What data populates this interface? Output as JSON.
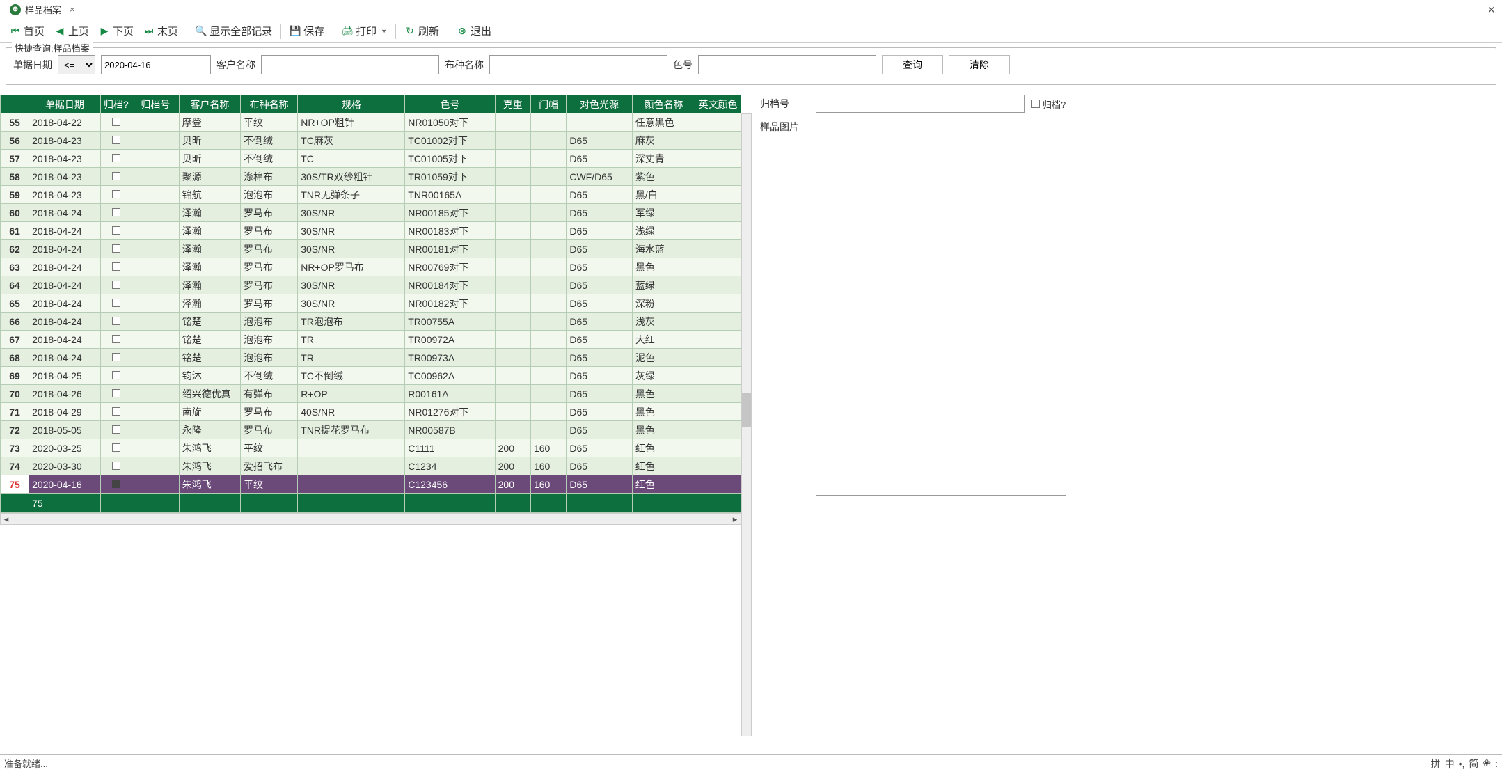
{
  "tab": {
    "title": "样品档案",
    "close": "×"
  },
  "window_close": "×",
  "toolbar": {
    "first": "首页",
    "prev": "上页",
    "next": "下页",
    "last": "末页",
    "showall": "显示全部记录",
    "save": "保存",
    "print": "打印",
    "refresh": "刷新",
    "exit": "退出"
  },
  "query": {
    "legend": "快捷查询:样品档案",
    "date_label": "单据日期",
    "op": "<=",
    "date": "2020-04-16",
    "cust_label": "客户名称",
    "cust": "",
    "fabric_label": "布种名称",
    "fabric": "",
    "color_label": "色号",
    "color": "",
    "search": "查询",
    "clear": "清除"
  },
  "columns": [
    "单据日期",
    "归档?",
    "归档号",
    "客户名称",
    "布种名称",
    "规格",
    "色号",
    "克重",
    "门幅",
    "对色光源",
    "颜色名称",
    "英文颜色"
  ],
  "rows": [
    {
      "n": "55",
      "date": "2018-04-22",
      "arch": false,
      "archno": "",
      "cust": "摩登",
      "fabric": "平纹",
      "spec": "NR+OP粗针",
      "colorno": "NR01050对下",
      "weight": "",
      "width": "",
      "light": "",
      "colorname": "任意黑色",
      "eng": ""
    },
    {
      "n": "56",
      "date": "2018-04-23",
      "arch": false,
      "archno": "",
      "cust": "贝昕",
      "fabric": "不倒绒",
      "spec": "TC麻灰",
      "colorno": "TC01002对下",
      "weight": "",
      "width": "",
      "light": "D65",
      "colorname": "麻灰",
      "eng": ""
    },
    {
      "n": "57",
      "date": "2018-04-23",
      "arch": false,
      "archno": "",
      "cust": "贝昕",
      "fabric": "不倒绒",
      "spec": "TC",
      "colorno": "TC01005对下",
      "weight": "",
      "width": "",
      "light": "D65",
      "colorname": "深丈青",
      "eng": ""
    },
    {
      "n": "58",
      "date": "2018-04-23",
      "arch": false,
      "archno": "",
      "cust": "聚源",
      "fabric": "涤棉布",
      "spec": "30S/TR双纱粗针",
      "colorno": "TR01059对下",
      "weight": "",
      "width": "",
      "light": "CWF/D65",
      "colorname": "紫色",
      "eng": ""
    },
    {
      "n": "59",
      "date": "2018-04-23",
      "arch": false,
      "archno": "",
      "cust": "锦航",
      "fabric": "泡泡布",
      "spec": "TNR无弹条子",
      "colorno": "TNR00165A",
      "weight": "",
      "width": "",
      "light": "D65",
      "colorname": "黑/白",
      "eng": ""
    },
    {
      "n": "60",
      "date": "2018-04-24",
      "arch": false,
      "archno": "",
      "cust": "泽瀚",
      "fabric": "罗马布",
      "spec": "30S/NR",
      "colorno": "NR00185对下",
      "weight": "",
      "width": "",
      "light": "D65",
      "colorname": "军绿",
      "eng": ""
    },
    {
      "n": "61",
      "date": "2018-04-24",
      "arch": false,
      "archno": "",
      "cust": "泽瀚",
      "fabric": "罗马布",
      "spec": "30S/NR",
      "colorno": "NR00183对下",
      "weight": "",
      "width": "",
      "light": "D65",
      "colorname": "浅绿",
      "eng": ""
    },
    {
      "n": "62",
      "date": "2018-04-24",
      "arch": false,
      "archno": "",
      "cust": "泽瀚",
      "fabric": "罗马布",
      "spec": "30S/NR",
      "colorno": "NR00181对下",
      "weight": "",
      "width": "",
      "light": "D65",
      "colorname": "海水蓝",
      "eng": ""
    },
    {
      "n": "63",
      "date": "2018-04-24",
      "arch": false,
      "archno": "",
      "cust": "泽瀚",
      "fabric": "罗马布",
      "spec": "NR+OP罗马布",
      "colorno": "NR00769对下",
      "weight": "",
      "width": "",
      "light": "D65",
      "colorname": "黑色",
      "eng": ""
    },
    {
      "n": "64",
      "date": "2018-04-24",
      "arch": false,
      "archno": "",
      "cust": "泽瀚",
      "fabric": "罗马布",
      "spec": "30S/NR",
      "colorno": "NR00184对下",
      "weight": "",
      "width": "",
      "light": "D65",
      "colorname": "蓝绿",
      "eng": ""
    },
    {
      "n": "65",
      "date": "2018-04-24",
      "arch": false,
      "archno": "",
      "cust": "泽瀚",
      "fabric": "罗马布",
      "spec": "30S/NR",
      "colorno": "NR00182对下",
      "weight": "",
      "width": "",
      "light": "D65",
      "colorname": "深粉",
      "eng": ""
    },
    {
      "n": "66",
      "date": "2018-04-24",
      "arch": false,
      "archno": "",
      "cust": "铭楚",
      "fabric": "泡泡布",
      "spec": "TR泡泡布",
      "colorno": "TR00755A",
      "weight": "",
      "width": "",
      "light": "D65",
      "colorname": "浅灰",
      "eng": ""
    },
    {
      "n": "67",
      "date": "2018-04-24",
      "arch": false,
      "archno": "",
      "cust": "铭楚",
      "fabric": "泡泡布",
      "spec": "TR",
      "colorno": "TR00972A",
      "weight": "",
      "width": "",
      "light": "D65",
      "colorname": "大红",
      "eng": ""
    },
    {
      "n": "68",
      "date": "2018-04-24",
      "arch": false,
      "archno": "",
      "cust": "铭楚",
      "fabric": "泡泡布",
      "spec": "TR",
      "colorno": "TR00973A",
      "weight": "",
      "width": "",
      "light": "D65",
      "colorname": "泥色",
      "eng": ""
    },
    {
      "n": "69",
      "date": "2018-04-25",
      "arch": false,
      "archno": "",
      "cust": "钧沐",
      "fabric": "不倒绒",
      "spec": "TC不倒绒",
      "colorno": "TC00962A",
      "weight": "",
      "width": "",
      "light": "D65",
      "colorname": "灰绿",
      "eng": ""
    },
    {
      "n": "70",
      "date": "2018-04-26",
      "arch": false,
      "archno": "",
      "cust": "绍兴德优真",
      "fabric": "有弹布",
      "spec": "R+OP",
      "colorno": "R00161A",
      "weight": "",
      "width": "",
      "light": "D65",
      "colorname": "黑色",
      "eng": ""
    },
    {
      "n": "71",
      "date": "2018-04-29",
      "arch": false,
      "archno": "",
      "cust": "南旋",
      "fabric": "罗马布",
      "spec": "40S/NR",
      "colorno": "NR01276对下",
      "weight": "",
      "width": "",
      "light": "D65",
      "colorname": "黑色",
      "eng": ""
    },
    {
      "n": "72",
      "date": "2018-05-05",
      "arch": false,
      "archno": "",
      "cust": "永隆",
      "fabric": "罗马布",
      "spec": "TNR提花罗马布",
      "colorno": "NR00587B",
      "weight": "",
      "width": "",
      "light": "D65",
      "colorname": "黑色",
      "eng": ""
    },
    {
      "n": "73",
      "date": "2020-03-25",
      "arch": false,
      "archno": "",
      "cust": "朱鸿飞",
      "fabric": "平纹",
      "spec": "",
      "colorno": "C1111",
      "weight": "200",
      "width": "160",
      "light": "D65",
      "colorname": "红色",
      "eng": ""
    },
    {
      "n": "74",
      "date": "2020-03-30",
      "arch": false,
      "archno": "",
      "cust": "朱鸿飞",
      "fabric": "爱招飞布",
      "spec": "",
      "colorno": "C1234",
      "weight": "200",
      "width": "160",
      "light": "D65",
      "colorname": "红色",
      "eng": ""
    },
    {
      "n": "75",
      "date": "2020-04-16",
      "arch": true,
      "archno": "",
      "cust": "朱鸿飞",
      "fabric": "平纹",
      "spec": "",
      "colorno": "C123456",
      "weight": "200",
      "width": "160",
      "light": "D65",
      "colorname": "红色",
      "eng": "",
      "selected": true
    }
  ],
  "summary_count": "75",
  "right": {
    "archno_label": "归档号",
    "archno": "",
    "arch_label": "归档?",
    "arch": false,
    "image_label": "样品图片"
  },
  "status": "准备就绪...",
  "ime": {
    "t1": "拼",
    "t2": "中",
    "t3": "简",
    "t4": ":"
  }
}
